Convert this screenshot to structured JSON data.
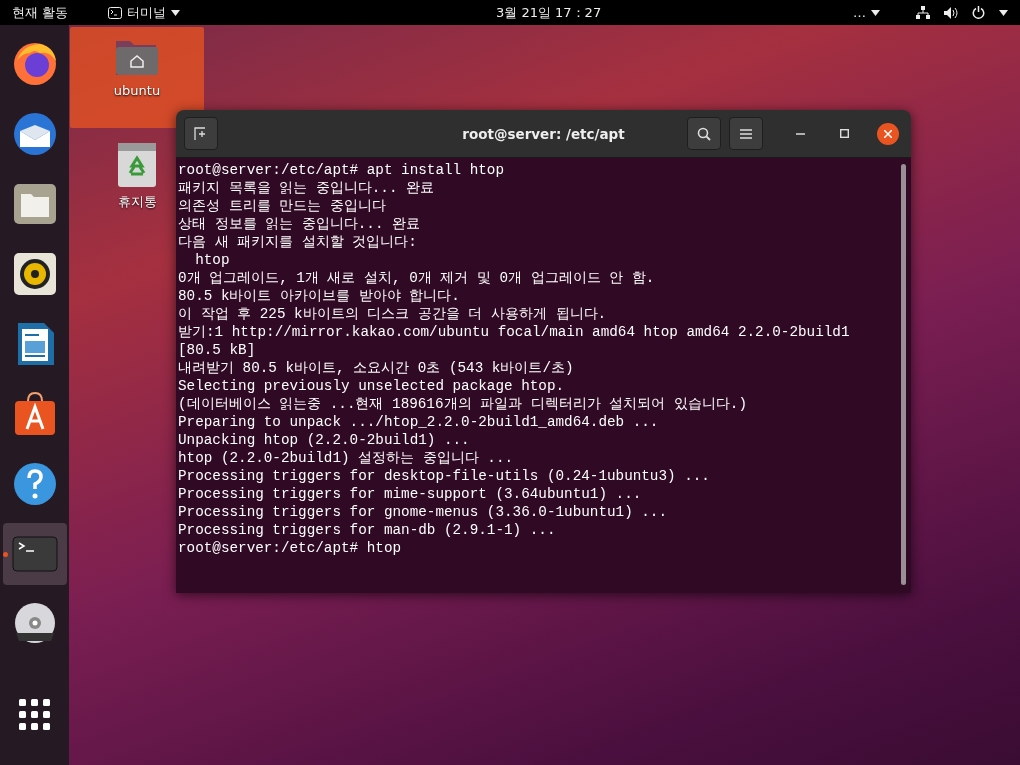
{
  "top_bar": {
    "activities": "현재 활동",
    "app_menu": "터미널",
    "clock": "3월 21일  17：27",
    "overflow": "…"
  },
  "dock": [
    {
      "kind": "browser",
      "selected": false,
      "running": false
    },
    {
      "kind": "mail",
      "selected": false,
      "running": false
    },
    {
      "kind": "files",
      "selected": false,
      "running": false
    },
    {
      "kind": "music",
      "selected": false,
      "running": false
    },
    {
      "kind": "writer",
      "selected": false,
      "running": false
    },
    {
      "kind": "store",
      "selected": false,
      "running": false
    },
    {
      "kind": "help",
      "selected": false,
      "running": false
    },
    {
      "kind": "terminal",
      "selected": true,
      "running": true
    },
    {
      "kind": "dvd",
      "selected": false,
      "running": false
    }
  ],
  "desktop_icons": [
    {
      "kind": "home",
      "label": "ubuntu",
      "selected": true
    },
    {
      "kind": "trash",
      "label": "휴지통",
      "selected": false
    }
  ],
  "terminal": {
    "title": "root@server: /etc/apt",
    "lines": [
      "root@server:/etc/apt# apt install htop",
      "패키지 목록을 읽는 중입니다... 완료",
      "의존성 트리를 만드는 중입니다",
      "상태 정보를 읽는 중입니다... 완료",
      "다음 새 패키지를 설치할 것입니다:",
      "  htop",
      "0개 업그레이드, 1개 새로 설치, 0개 제거 및 0개 업그레이드 안 함.",
      "80.5 k바이트 아카이브를 받아야 합니다.",
      "이 작업 후 225 k바이트의 디스크 공간을 더 사용하게 됩니다.",
      "받기:1 http://mirror.kakao.com/ubuntu focal/main amd64 htop amd64 2.2.0-2build1",
      "[80.5 kB]",
      "내려받기 80.5 k바이트, 소요시간 0초 (543 k바이트/초)",
      "Selecting previously unselected package htop.",
      "(데이터베이스 읽는중 ...현재 189616개의 파일과 디렉터리가 설치되어 있습니다.)",
      "Preparing to unpack .../htop_2.2.0-2build1_amd64.deb ...",
      "Unpacking htop (2.2.0-2build1) ...",
      "htop (2.2.0-2build1) 설정하는 중입니다 ...",
      "Processing triggers for desktop-file-utils (0.24-1ubuntu3) ...",
      "Processing triggers for mime-support (3.64ubuntu1) ...",
      "Processing triggers for gnome-menus (3.36.0-1ubuntu1) ...",
      "Processing triggers for man-db (2.9.1-1) ...",
      "root@server:/etc/apt# htop"
    ]
  }
}
